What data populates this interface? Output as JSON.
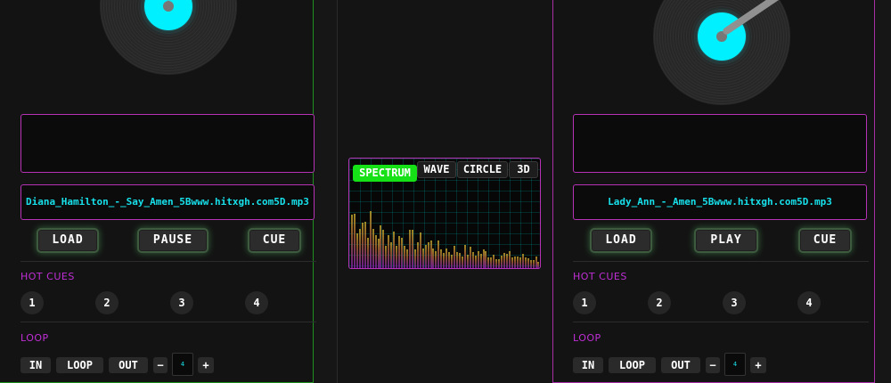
{
  "deck_a": {
    "filename": "Diana_Hamilton_-_Say_Amen_5Bwww.hitxgh.com5D.mp3",
    "buttons": {
      "load": "LOAD",
      "play_pause": "PAUSE",
      "cue": "CUE"
    },
    "hot_cues_label": "HOT CUES",
    "hot_cues": [
      "1",
      "2",
      "3",
      "4"
    ],
    "loop_label": "LOOP",
    "loop": {
      "in": "IN",
      "loop": "LOOP",
      "out": "OUT",
      "minus": "−",
      "length": "4",
      "plus": "+"
    }
  },
  "deck_b": {
    "filename": "Lady_Ann_-_Amen_5Bwww.hitxgh.com5D.mp3",
    "buttons": {
      "load": "LOAD",
      "play_pause": "PLAY",
      "cue": "CUE"
    },
    "hot_cues_label": "HOT CUES",
    "hot_cues": [
      "1",
      "2",
      "3",
      "4"
    ],
    "loop_label": "LOOP",
    "loop": {
      "in": "IN",
      "loop": "LOOP",
      "out": "OUT",
      "minus": "−",
      "length": "4",
      "plus": "+"
    }
  },
  "visualizer": {
    "modes": [
      "SPECTRUM",
      "WAVE",
      "CIRCLE",
      "3D"
    ],
    "active_mode": "SPECTRUM"
  },
  "colors": {
    "deck_a_border": "#1f8f1f",
    "deck_b_border": "#a62fa6",
    "record_label": "#00f0ff",
    "accent_magenta": "#c02ed6",
    "active_tab": "#16e016"
  },
  "icons": {
    "turntable": "vinyl-record-icon",
    "tonearm": "tonearm-icon"
  }
}
